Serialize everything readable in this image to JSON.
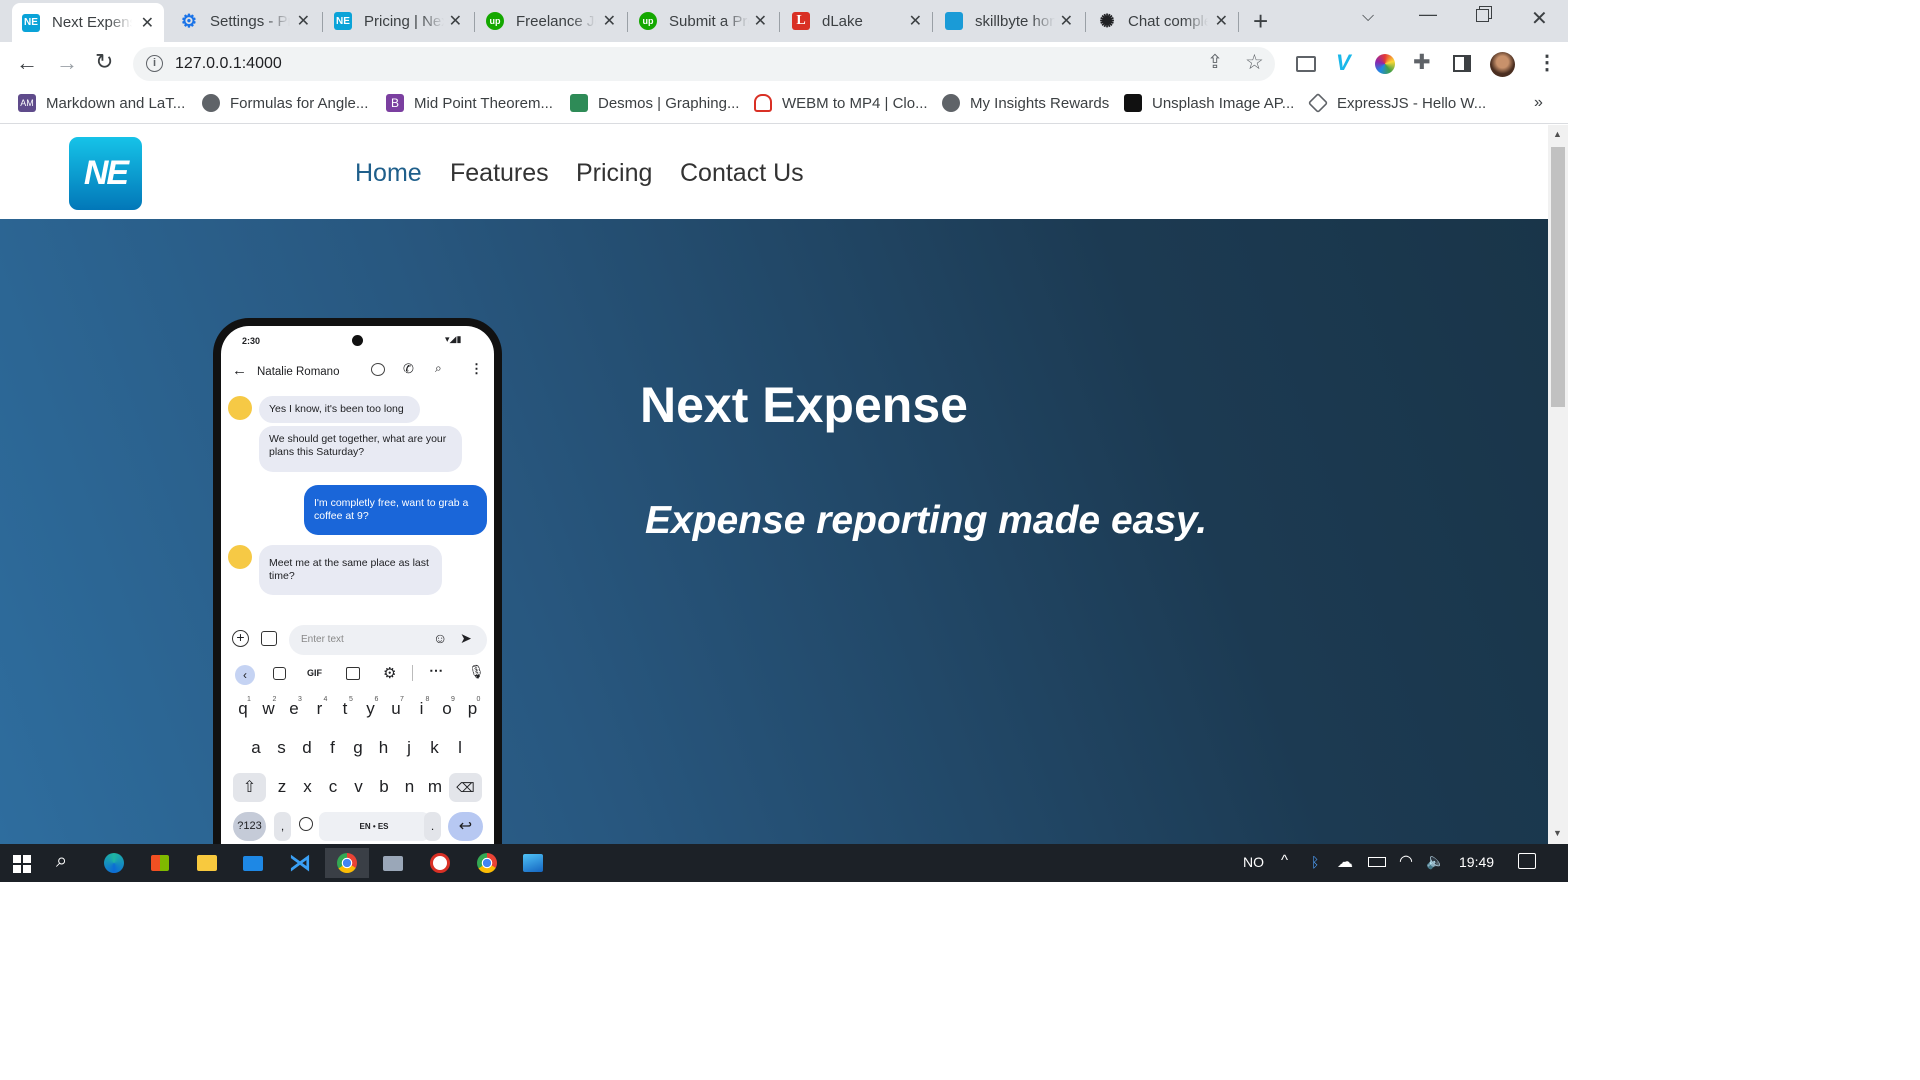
{
  "browser": {
    "tabs": [
      {
        "title": "Next Expense",
        "icon": "ne-logo-icon",
        "color": "#0aa3d8",
        "active": true
      },
      {
        "title": "Settings - Pricing",
        "icon": "gear-icon",
        "color": "#1a73e8"
      },
      {
        "title": "Pricing | Next Expense",
        "icon": "ne-logo-icon",
        "color": "#0aa3d8"
      },
      {
        "title": "Freelance Jobs",
        "icon": "upwork-icon",
        "color": "#14a800"
      },
      {
        "title": "Submit a Proposal",
        "icon": "upwork-icon",
        "color": "#14a800"
      },
      {
        "title": "dLake",
        "icon": "l-icon",
        "color": "#d93025"
      },
      {
        "title": "skillbyte home",
        "icon": "skillbyte-icon",
        "color": "#1a9bd7"
      },
      {
        "title": "Chat completion",
        "icon": "openai-icon",
        "color": "#202124"
      }
    ],
    "url": "127.0.0.1:4000",
    "bookmarks": [
      {
        "label": "Markdown and LaT...",
        "color": "#5f4b8b"
      },
      {
        "label": "Formulas for Angle...",
        "color": "#5f6368"
      },
      {
        "label": "Mid Point Theorem...",
        "color": "#7b3fa0"
      },
      {
        "label": "Desmos | Graphing...",
        "color": "#2e8b57"
      },
      {
        "label": "WEBM to MP4 | Clo...",
        "color": "#d93025"
      },
      {
        "label": "My Insights Rewards",
        "color": "#5f6368"
      },
      {
        "label": "Unsplash Image AP...",
        "color": "#111111"
      },
      {
        "label": "ExpressJS - Hello W...",
        "color": "#5f6368"
      }
    ],
    "more_bookmarks": "»"
  },
  "site": {
    "logo_text": "NE",
    "nav": [
      "Home",
      "Features",
      "Pricing",
      "Contact Us"
    ],
    "hero_title": "Next Expense",
    "hero_tagline": "Expense reporting made easy."
  },
  "phone": {
    "time": "2:30",
    "contact": "Natalie Romano",
    "messages": [
      {
        "text": "Yes I know, it's been too long",
        "dir": "in"
      },
      {
        "text": "We should get together, what are your plans this Saturday?",
        "dir": "in"
      },
      {
        "text": "I'm completly free, want to grab a coffee at 9?",
        "dir": "out"
      },
      {
        "text": "Meet me at the same place as last time?",
        "dir": "in"
      }
    ],
    "input_placeholder": "Enter text",
    "gif_label": "GIF",
    "keys_row1": [
      "q",
      "w",
      "e",
      "r",
      "t",
      "y",
      "u",
      "i",
      "o",
      "p"
    ],
    "nums_row1": [
      "1",
      "2",
      "3",
      "4",
      "5",
      "6",
      "7",
      "8",
      "9",
      "0"
    ],
    "keys_row2": [
      "a",
      "s",
      "d",
      "f",
      "g",
      "h",
      "j",
      "k",
      "l"
    ],
    "keys_row3": [
      "z",
      "x",
      "c",
      "v",
      "b",
      "n",
      "m"
    ],
    "sym_key": "?123",
    "comma_key": ",",
    "space_label": "EN • ES",
    "period_key": "."
  },
  "taskbar": {
    "lang": "NO",
    "clock": "19:49"
  }
}
